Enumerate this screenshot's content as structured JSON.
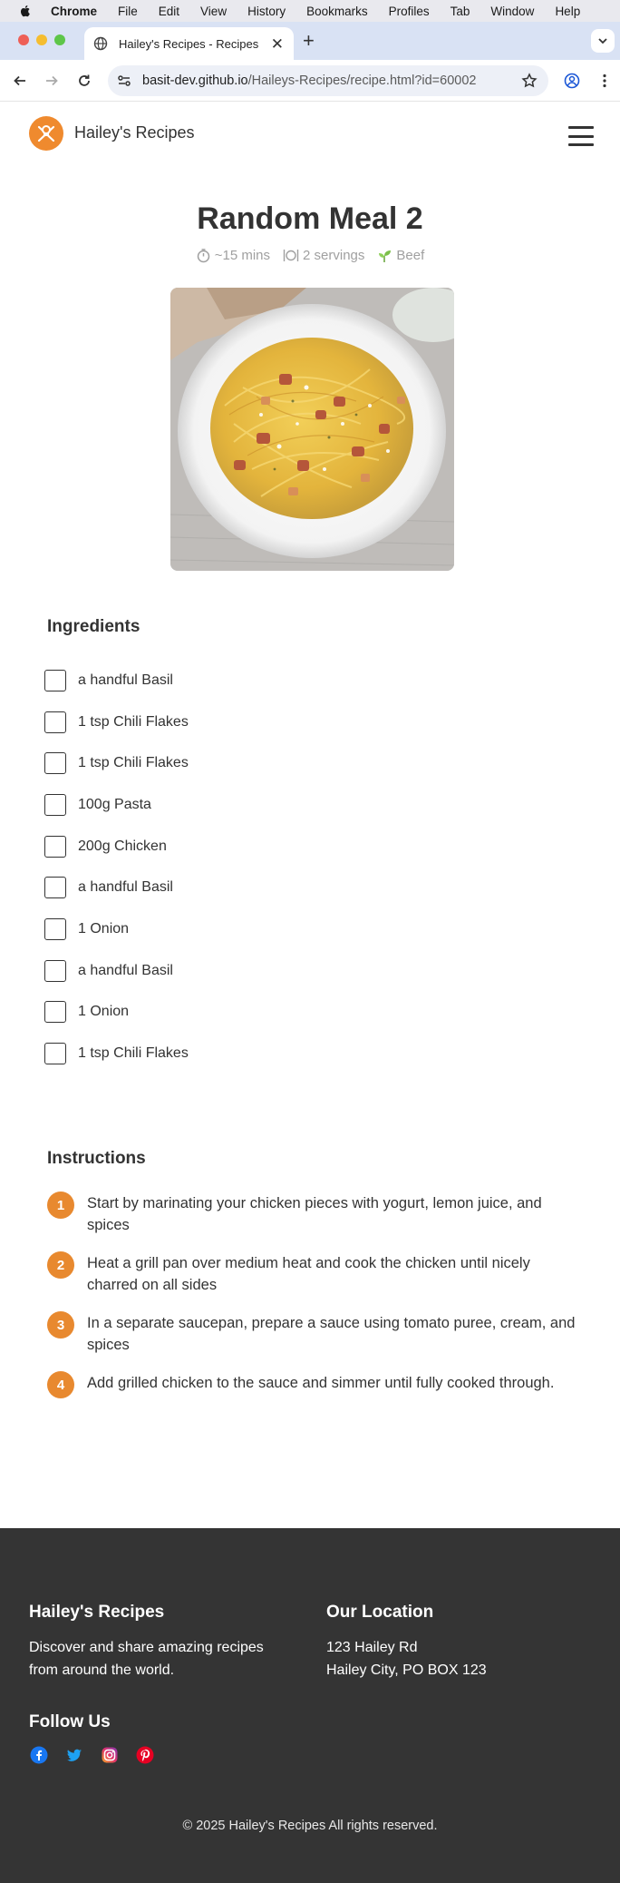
{
  "menubar": {
    "app": "Chrome",
    "items": [
      "File",
      "Edit",
      "View",
      "History",
      "Bookmarks",
      "Profiles",
      "Tab",
      "Window",
      "Help"
    ]
  },
  "browser": {
    "tab_title": "Hailey's Recipes - Recipes",
    "url_host": "basit-dev.github.io",
    "url_path": "/Haileys-Recipes/recipe.html?id=60002"
  },
  "site": {
    "brand": "Hailey's Recipes"
  },
  "recipe": {
    "title": "Random Meal 2",
    "time": "~15 mins",
    "servings": "2 servings",
    "category": "Beef",
    "ingredients_heading": "Ingredients",
    "ingredients": [
      "a handful Basil",
      "1 tsp Chili Flakes",
      "1 tsp Chili Flakes",
      "100g Pasta",
      "200g Chicken",
      "a handful Basil",
      "1 Onion",
      "a handful Basil",
      "1 Onion",
      "1 tsp Chili Flakes"
    ],
    "instructions_heading": "Instructions",
    "steps": [
      {
        "num": "1",
        "text": "Start by marinating your chicken pieces with yogurt, lemon juice, and spices"
      },
      {
        "num": "2",
        "text": "Heat a grill pan over medium heat and cook the chicken until nicely charred on all sides"
      },
      {
        "num": "3",
        "text": "In a separate saucepan, prepare a sauce using tomato puree, cream, and spices"
      },
      {
        "num": "4",
        "text": "Add grilled chicken to the sauce and simmer until fully cooked through."
      }
    ]
  },
  "footer": {
    "brand_title": "Hailey's Recipes",
    "brand_text_1": "Discover and share amazing recipes",
    "brand_text_2": "from around the world.",
    "location_title": "Our Location",
    "address_1": "123 Hailey Rd",
    "address_2": "Hailey City, PO BOX 123",
    "follow_title": "Follow Us",
    "copyright": "© 2025 Hailey's Recipes All rights reserved."
  },
  "colors": {
    "accent": "#e8892f",
    "footer_bg": "#343434"
  }
}
